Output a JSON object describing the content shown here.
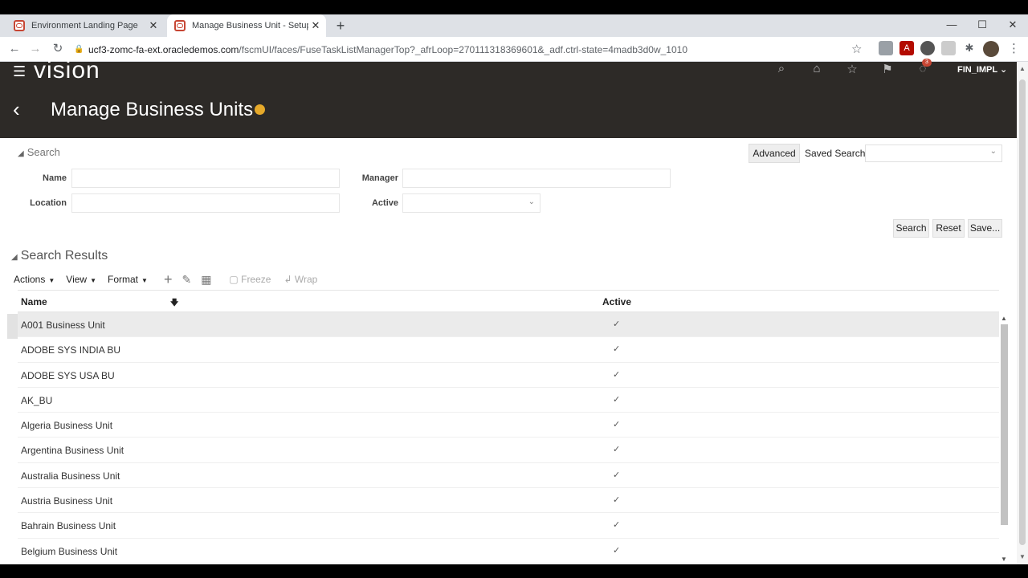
{
  "browser": {
    "tabs": [
      {
        "title": "Environment Landing Page",
        "active": false
      },
      {
        "title": "Manage Business Unit - Setup an",
        "active": true
      }
    ],
    "new_tab_icon": "plus-icon",
    "url_host": "ucf3-zomc-fa-ext.oracledemos.com",
    "url_path": "/fscmUI/faces/FuseTaskListManagerTop?_afrLoop=270111318369601&_adf.ctrl-state=4madb3d0w_1010"
  },
  "app": {
    "brand": "vision",
    "user": "FIN_IMPL",
    "notification_count": "3",
    "page_title": "Manage Business Units"
  },
  "search": {
    "header": "Search",
    "advanced_label": "Advanced",
    "saved_search_label": "Saved Search",
    "fields": {
      "name_label": "Name",
      "manager_label": "Manager",
      "location_label": "Location",
      "active_label": "Active"
    },
    "buttons": {
      "search": "Search",
      "reset": "Reset",
      "save": "Save..."
    }
  },
  "results": {
    "header": "Search Results",
    "toolbar": {
      "actions": "Actions",
      "view": "View",
      "format": "Format",
      "freeze": "Freeze",
      "wrap": "Wrap"
    },
    "columns": {
      "name": "Name",
      "active": "Active"
    },
    "check_mark": "✓",
    "rows": [
      {
        "name": "A001 Business Unit",
        "active": true
      },
      {
        "name": "ADOBE SYS INDIA BU",
        "active": true
      },
      {
        "name": "ADOBE SYS USA BU",
        "active": true
      },
      {
        "name": "AK_BU",
        "active": true
      },
      {
        "name": "Algeria Business Unit",
        "active": true
      },
      {
        "name": "Argentina Business Unit",
        "active": true
      },
      {
        "name": "Australia Business Unit",
        "active": true
      },
      {
        "name": "Austria Business Unit",
        "active": true
      },
      {
        "name": "Bahrain Business Unit",
        "active": true
      },
      {
        "name": "Belgium Business Unit",
        "active": true
      }
    ]
  }
}
